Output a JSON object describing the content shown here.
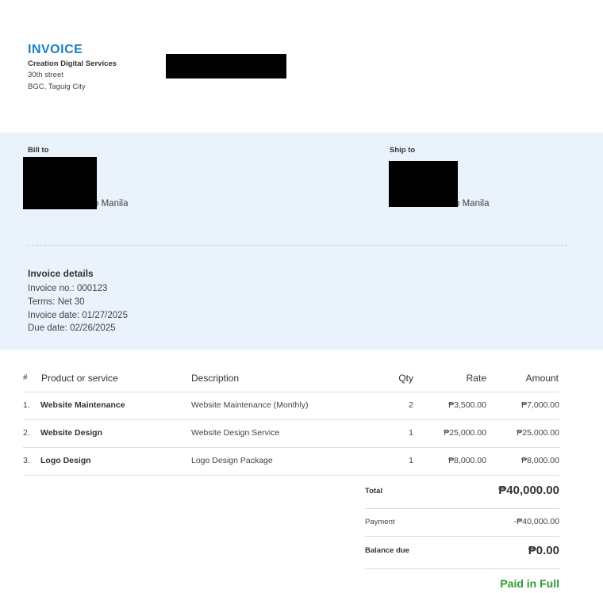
{
  "header": {
    "title": "INVOICE",
    "company_name": "Creation Digital Services",
    "address_line1": "30th street",
    "address_line2": "BGC, Taguig City"
  },
  "bill_to": {
    "label": "Bill to",
    "city_visible": "o Manila"
  },
  "ship_to": {
    "label": "Ship to",
    "city_visible": "o Manila"
  },
  "invoice_details": {
    "title": "Invoice details",
    "invoice_no": "Invoice no.: 000123",
    "terms": "Terms: Net 30",
    "invoice_date": "Invoice date: 01/27/2025",
    "due_date": "Due date: 02/26/2025"
  },
  "table": {
    "headers": [
      "#",
      "Product or service",
      "Description",
      "Qty",
      "Rate",
      "Amount"
    ],
    "rows": [
      {
        "index": "1.",
        "product": "Website Maintenance",
        "description": "Website Maintenance (Monthly)",
        "qty": "2",
        "rate": "₱3,500.00",
        "amount": "₱7,000.00"
      },
      {
        "index": "2.",
        "product": "Website Design",
        "description": "Website Design Service",
        "qty": "1",
        "rate": "₱25,000.00",
        "amount": "₱25,000.00"
      },
      {
        "index": "3.",
        "product": "Logo Design",
        "description": "Logo Design Package",
        "qty": "1",
        "rate": "₱8,000.00",
        "amount": "₱8,000.00"
      }
    ]
  },
  "totals": {
    "total_label": "Total",
    "total_value": "₱40,000.00",
    "payment_label": "Payment",
    "payment_value": "-₱40,000.00",
    "balance_label": "Balance due",
    "balance_value": "₱0.00",
    "status": "Paid in Full",
    "status_color": "#2a9d2f"
  },
  "colors": {
    "accent": "#1a7fc1",
    "band": "#eaf3fb"
  }
}
